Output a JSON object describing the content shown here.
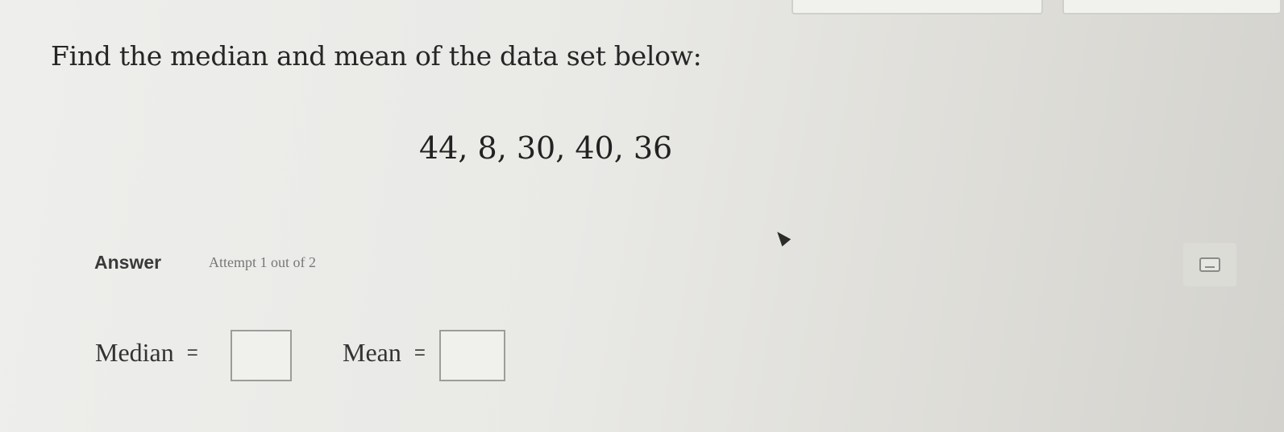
{
  "question": {
    "prompt": "Find the median and mean of the data set below:",
    "data_set": "44, 8, 30, 40, 36"
  },
  "answer": {
    "heading": "Answer",
    "attempt": "Attempt 1 out of 2",
    "median_label": "Median",
    "mean_label": "Mean",
    "equals": "=",
    "median_value": "",
    "mean_value": ""
  },
  "icons": {
    "keyboard": "keyboard-icon",
    "cursor": "mouse-cursor-icon"
  }
}
